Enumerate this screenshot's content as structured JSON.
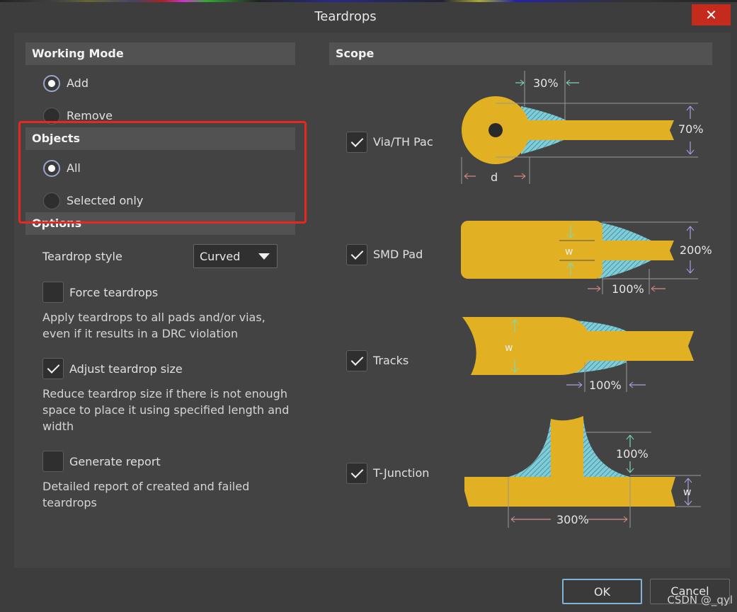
{
  "window": {
    "title": "Teardrops",
    "close_glyph": "✕"
  },
  "working_mode": {
    "header": "Working Mode",
    "options": [
      {
        "label": "Add",
        "selected": true
      },
      {
        "label": "Remove",
        "selected": false
      }
    ]
  },
  "objects": {
    "header": "Objects",
    "options": [
      {
        "label": "All",
        "selected": true
      },
      {
        "label": "Selected only",
        "selected": false
      }
    ]
  },
  "options": {
    "header": "Options",
    "teardrop_style": {
      "label": "Teardrop style",
      "value": "Curved"
    },
    "force_teardrops": {
      "label": "Force teardrops",
      "checked": false,
      "description": "Apply teardrops to all pads and/or vias,\neven if it results in a DRC violation"
    },
    "adjust_size": {
      "label": "Adjust teardrop size",
      "checked": true,
      "description": "Reduce teardrop size if there is not enough\nspace to place it using specified length and\nwidth"
    },
    "generate_report": {
      "label": "Generate report",
      "checked": false,
      "description": "Detailed report of created and failed\nteardrops"
    }
  },
  "scope": {
    "header": "Scope",
    "items": [
      {
        "label": "Via/TH Pac",
        "checked": true
      },
      {
        "label": "SMD Pad",
        "checked": true
      },
      {
        "label": "Tracks",
        "checked": true
      },
      {
        "label": "T-Junction",
        "checked": true
      }
    ],
    "diagrams": {
      "via": {
        "length": "30%",
        "width": "70%",
        "d": "d"
      },
      "smd": {
        "w": "w",
        "width": "200%",
        "length": "100%"
      },
      "tracks": {
        "w": "w",
        "length": "100%"
      },
      "tjunction": {
        "height": "100%",
        "w": "w",
        "length": "300%"
      }
    }
  },
  "buttons": {
    "ok": "OK",
    "cancel": "Cancel"
  },
  "watermark": "CSDN @_qyl",
  "colors": {
    "copper": "#e1b023",
    "teardrop_fill": "#7ecdd9",
    "arrow_green": "#7fd8b0",
    "arrow_red": "#d98a8a",
    "arrow_purple": "#a8a0e0",
    "highlight": "#e8271e",
    "close": "#c42b1c"
  }
}
